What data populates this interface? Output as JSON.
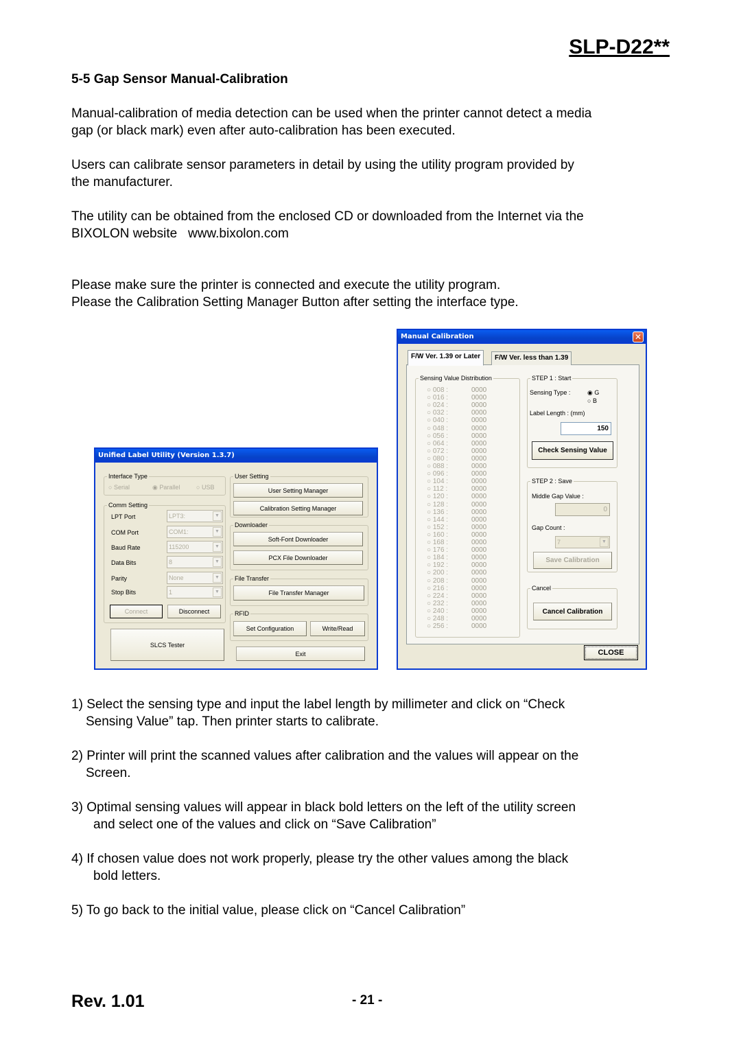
{
  "header": {
    "model": "SLP-D22**"
  },
  "section": {
    "title": "5-5 Gap Sensor Manual-Calibration"
  },
  "paragraphs": [
    [
      "Manual-calibration of media detection can be used when the printer cannot detect a media",
      "gap (or black mark) even after auto-calibration has been executed."
    ],
    [
      "Users can calibrate sensor parameters in detail by using the utility program provided by",
      "the manufacturer."
    ],
    [
      "The utility can be obtained from the enclosed CD or downloaded from the Internet via the",
      "BIXOLON website   www.bixolon.com"
    ],
    [
      "Please make sure the printer is connected and execute the utility program.",
      "Please the Calibration Setting Manager Button after setting the interface type."
    ]
  ],
  "steps": [
    {
      "num": "1)",
      "lines": [
        "Select the sensing type and input the label length by millimeter and click on “Check",
        "Sensing Value” tap. Then printer starts to calibrate."
      ]
    },
    {
      "num": "2)",
      "lines": [
        "Printer will print the scanned values after calibration and the values will appear on the",
        "Screen."
      ]
    },
    {
      "num": "3)",
      "lines": [
        "Optimal sensing values will appear in black bold letters on the left of the utility screen",
        "and select one of the values and click on “Save Calibration”"
      ]
    },
    {
      "num": "4)",
      "lines": [
        "If chosen value does not work properly, please try the other values among the black",
        "bold letters."
      ]
    },
    {
      "num": "5)",
      "lines": [
        "To go back to the initial value, please click on “Cancel Calibration”"
      ]
    }
  ],
  "footer": {
    "rev": "Rev. 1.01",
    "page": "- 21 -"
  },
  "unified_utility": {
    "title": "Unified Label Utility  (Version 1.3.7)",
    "interface_type": {
      "label": "Interface Type",
      "options": [
        "Serial",
        "Parallel",
        "USB"
      ],
      "selected": "Parallel"
    },
    "comm_setting": {
      "label": "Comm Setting",
      "fields": [
        {
          "label": "LPT Port",
          "value": "LPT3:"
        },
        {
          "label": "COM Port",
          "value": "COM1:"
        },
        {
          "label": "Baud Rate",
          "value": "115200"
        },
        {
          "label": "Data Bits",
          "value": "8"
        },
        {
          "label": "Parity",
          "value": "None"
        },
        {
          "label": "Stop Bits",
          "value": "1"
        }
      ],
      "connect": "Connect",
      "disconnect": "Disconnect"
    },
    "slcs_tester": "SLCS Tester",
    "user_setting": {
      "label": "User Setting",
      "user_setting_manager": "User Setting Manager",
      "calibration_setting_manager": "Calibration Setting Manager"
    },
    "downloader": {
      "label": "Downloader",
      "soft_font": "Soft-Font Downloader",
      "pcx": "PCX File Downloader"
    },
    "file_transfer": {
      "label": "File Transfer",
      "manager": "File Transfer Manager"
    },
    "rfid": {
      "label": "RFID",
      "set_configuration": "Set Configuration",
      "write_read": "Write/Read"
    },
    "exit": "Exit"
  },
  "manual_calibration": {
    "title": "Manual Calibration",
    "close_icon": "close-x",
    "tabs": [
      "F/W Ver. 1.39 or Later",
      "F/W Ver. less than 1.39"
    ],
    "active_tab": "F/W Ver. 1.39 or Later",
    "distribution": {
      "label": "Sensing Value Distribution",
      "rows": [
        {
          "key": "008 :",
          "value": "0000"
        },
        {
          "key": "016 :",
          "value": "0000"
        },
        {
          "key": "024 :",
          "value": "0000"
        },
        {
          "key": "032 :",
          "value": "0000"
        },
        {
          "key": "040 :",
          "value": "0000"
        },
        {
          "key": "048 :",
          "value": "0000"
        },
        {
          "key": "056 :",
          "value": "0000"
        },
        {
          "key": "064 :",
          "value": "0000"
        },
        {
          "key": "072 :",
          "value": "0000"
        },
        {
          "key": "080 :",
          "value": "0000"
        },
        {
          "key": "088 :",
          "value": "0000"
        },
        {
          "key": "096 :",
          "value": "0000"
        },
        {
          "key": "104 :",
          "value": "0000"
        },
        {
          "key": "112 :",
          "value": "0000"
        },
        {
          "key": "120 :",
          "value": "0000"
        },
        {
          "key": "128 :",
          "value": "0000"
        },
        {
          "key": "136 :",
          "value": "0000"
        },
        {
          "key": "144 :",
          "value": "0000"
        },
        {
          "key": "152 :",
          "value": "0000"
        },
        {
          "key": "160 :",
          "value": "0000"
        },
        {
          "key": "168 :",
          "value": "0000"
        },
        {
          "key": "176 :",
          "value": "0000"
        },
        {
          "key": "184 :",
          "value": "0000"
        },
        {
          "key": "192 :",
          "value": "0000"
        },
        {
          "key": "200 :",
          "value": "0000"
        },
        {
          "key": "208 :",
          "value": "0000"
        },
        {
          "key": "216 :",
          "value": "0000"
        },
        {
          "key": "224 :",
          "value": "0000"
        },
        {
          "key": "232 :",
          "value": "0000"
        },
        {
          "key": "240 :",
          "value": "0000"
        },
        {
          "key": "248 :",
          "value": "0000"
        },
        {
          "key": "256 :",
          "value": "0000"
        }
      ]
    },
    "step1": {
      "label": "STEP 1 : Start",
      "sensing_type_label": "Sensing Type :",
      "sensing_options": [
        "G",
        "B"
      ],
      "sensing_selected": "G",
      "label_length_label": "Label Length : (mm)",
      "label_length_value": "150",
      "check_button": "Check Sensing Value"
    },
    "step2": {
      "label": "STEP 2 : Save",
      "middle_gap_label": "Middle Gap Value :",
      "middle_gap_value": "0",
      "gap_count_label": "Gap Count :",
      "gap_count_value": "7",
      "save_button": "Save Calibration"
    },
    "cancel": {
      "label": "Cancel",
      "button": "Cancel Calibration"
    },
    "close_button": "CLOSE"
  }
}
